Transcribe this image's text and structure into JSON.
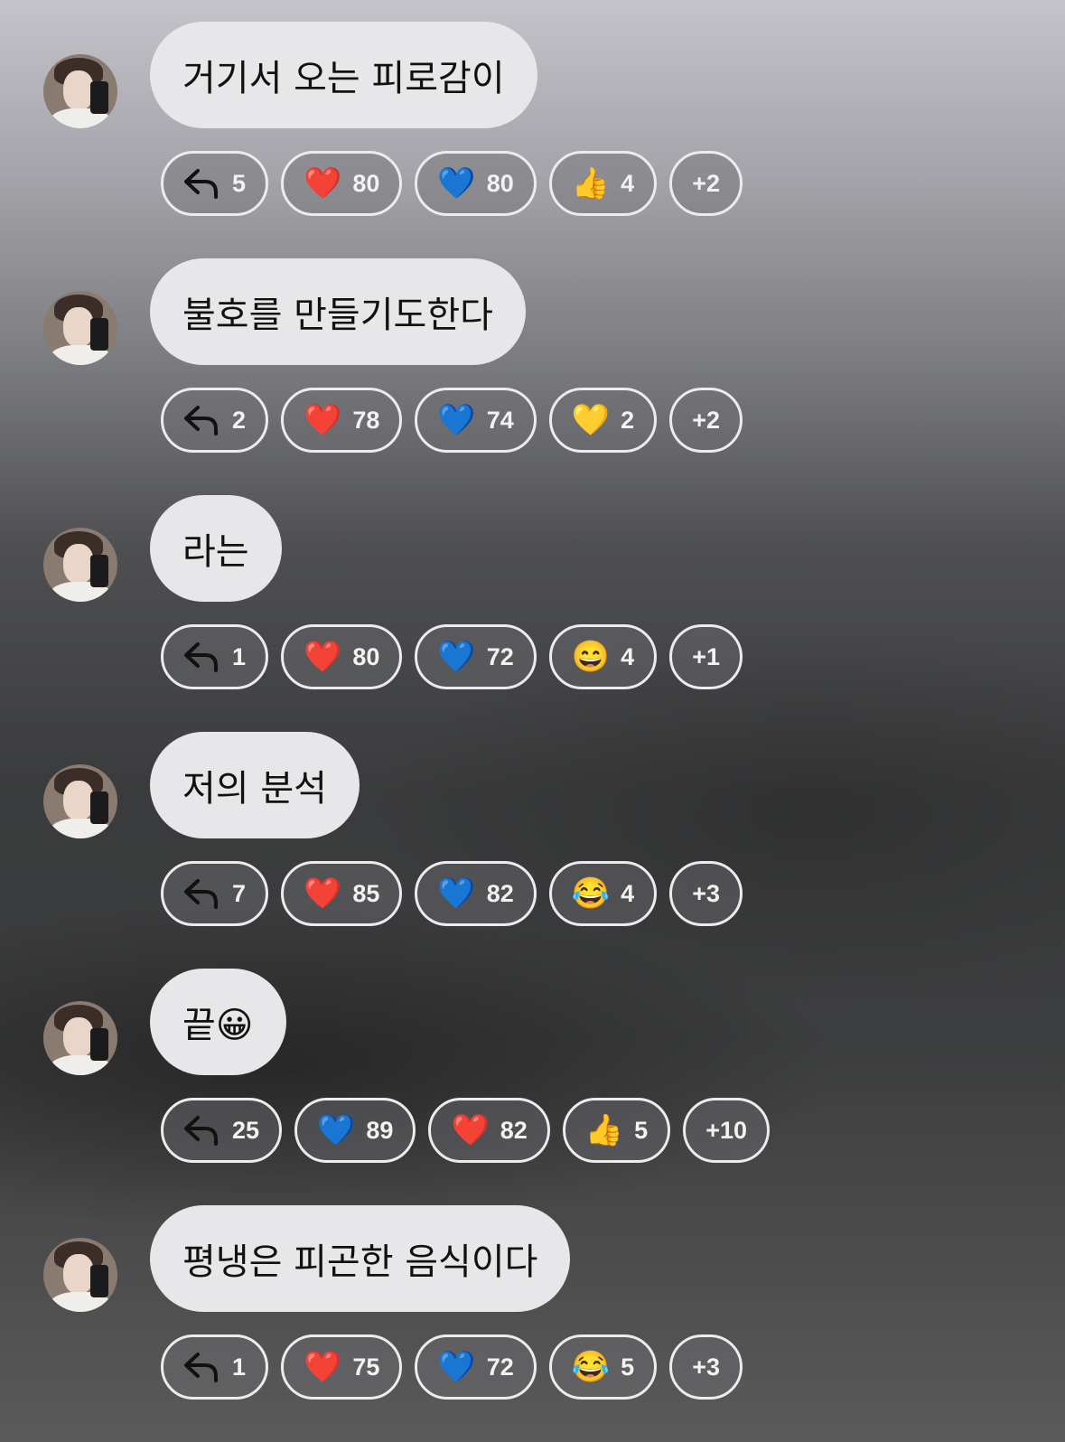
{
  "messages": [
    {
      "text": "거기서 오는 피로감이",
      "reactions": [
        {
          "kind": "reply",
          "count": "5"
        },
        {
          "emoji": "❤️",
          "count": "80"
        },
        {
          "emoji": "💙",
          "count": "80"
        },
        {
          "emoji": "👍",
          "count": "4"
        }
      ],
      "more": "+2"
    },
    {
      "text": "불호를 만들기도한다",
      "reactions": [
        {
          "kind": "reply",
          "count": "2"
        },
        {
          "emoji": "❤️",
          "count": "78"
        },
        {
          "emoji": "💙",
          "count": "74"
        },
        {
          "emoji": "💛",
          "count": "2"
        }
      ],
      "more": "+2"
    },
    {
      "text": "라는",
      "reactions": [
        {
          "kind": "reply",
          "count": "1"
        },
        {
          "emoji": "❤️",
          "count": "80"
        },
        {
          "emoji": "💙",
          "count": "72"
        },
        {
          "emoji": "😄",
          "count": "4"
        }
      ],
      "more": "+1"
    },
    {
      "text": "저의 분석",
      "reactions": [
        {
          "kind": "reply",
          "count": "7"
        },
        {
          "emoji": "❤️",
          "count": "85"
        },
        {
          "emoji": "💙",
          "count": "82"
        },
        {
          "emoji": "😂",
          "count": "4"
        }
      ],
      "more": "+3"
    },
    {
      "text": "끝😀",
      "reactions": [
        {
          "kind": "reply",
          "count": "25"
        },
        {
          "emoji": "💙",
          "count": "89"
        },
        {
          "emoji": "❤️",
          "count": "82"
        },
        {
          "emoji": "👍",
          "count": "5"
        }
      ],
      "more": "+10"
    },
    {
      "text": "평냉은 피곤한 음식이다",
      "reactions": [
        {
          "kind": "reply",
          "count": "1"
        },
        {
          "emoji": "❤️",
          "count": "75"
        },
        {
          "emoji": "💙",
          "count": "72"
        },
        {
          "emoji": "😂",
          "count": "5"
        }
      ],
      "more": "+3"
    }
  ],
  "icons": {
    "reply": "reply-arrow-icon",
    "avatar": "profile-avatar"
  },
  "colors": {
    "bubble": "#e7e7e9",
    "chip_border": "#ececee",
    "chip_text": "#f2f2f2"
  }
}
